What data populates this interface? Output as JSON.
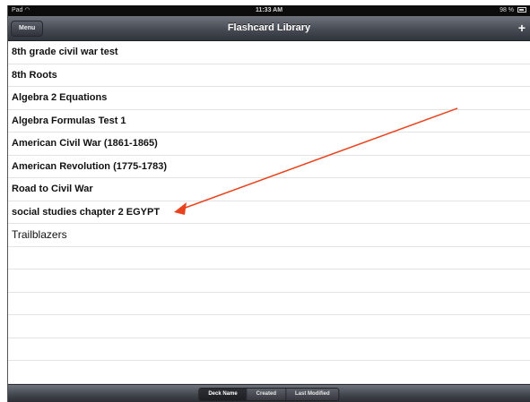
{
  "status_bar": {
    "device": "Pad",
    "wifi_icon": "wifi-icon",
    "time": "11:33 AM",
    "battery": "98 %",
    "battery_icon": "battery-icon"
  },
  "nav": {
    "menu_label": "Menu",
    "title": "Flashcard Library",
    "add_label": "+"
  },
  "decks": [
    "8th grade civil war test",
    "8th Roots",
    "Algebra 2 Equations",
    "Algebra Formulas Test 1",
    "American Civil War (1861-1865)",
    "American Revolution (1775-1783)",
    "Road to Civil War",
    "social studies chapter 2 EGYPT",
    "Trailblazers"
  ],
  "sort_tabs": [
    "Deck Name",
    "Created",
    "Last Modified"
  ],
  "selected_sort": "Deck Name",
  "colors": {
    "annotation_arrow": "#e8431e",
    "nav_bar": "#474b53"
  }
}
